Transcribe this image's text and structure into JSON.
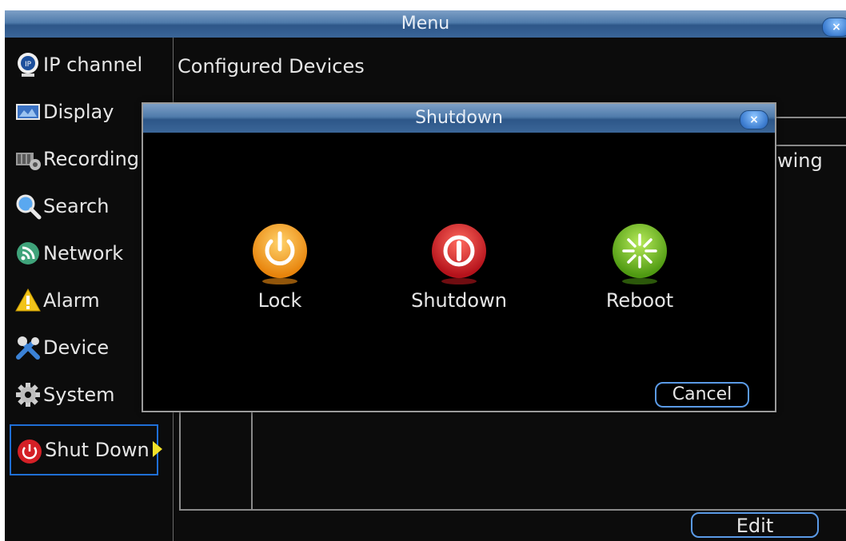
{
  "window": {
    "title": "Menu",
    "close_glyph": "×"
  },
  "sidebar": {
    "items": [
      {
        "label": "IP channel",
        "icon": "ip-camera-icon"
      },
      {
        "label": "Display",
        "icon": "display-icon"
      },
      {
        "label": "Recording",
        "icon": "recording-icon"
      },
      {
        "label": "Search",
        "icon": "search-icon"
      },
      {
        "label": "Network",
        "icon": "network-icon"
      },
      {
        "label": "Alarm",
        "icon": "alarm-warning-icon"
      },
      {
        "label": "Device",
        "icon": "device-tools-icon"
      },
      {
        "label": "System",
        "icon": "system-gear-icon"
      },
      {
        "label": "Shut Down",
        "icon": "power-icon",
        "selected": true
      }
    ]
  },
  "content": {
    "title": "Configured Devices",
    "partial_text": "wing",
    "edit_label": "Edit"
  },
  "dialog": {
    "title": "Shutdown",
    "close_glyph": "×",
    "options": [
      {
        "label": "Lock",
        "icon": "lock-power-icon",
        "color": "#f39a1e"
      },
      {
        "label": "Shutdown",
        "icon": "shutdown-power-icon",
        "color": "#d11f24"
      },
      {
        "label": "Reboot",
        "icon": "reboot-icon",
        "color": "#69b51f"
      }
    ],
    "cancel_label": "Cancel"
  },
  "colors": {
    "titlebar": "#4f7bab",
    "selection_border": "#1f6fd6",
    "button_border": "#5a9ae6",
    "background": "#0c0c0c"
  }
}
